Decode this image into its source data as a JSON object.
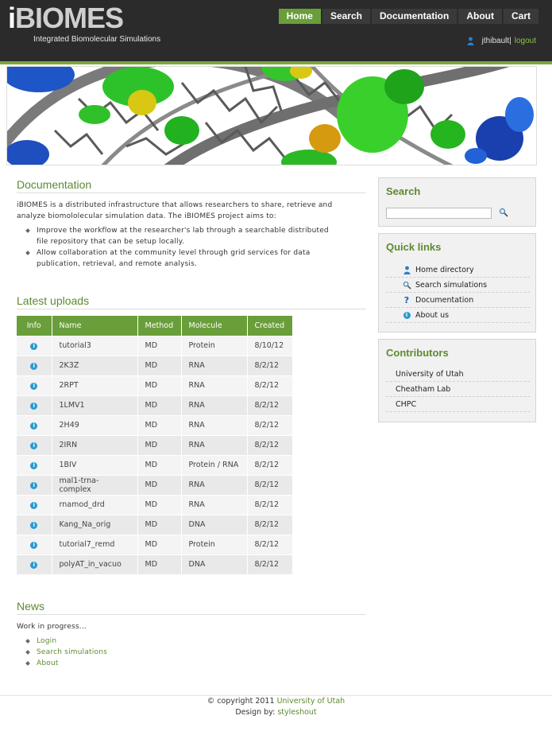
{
  "header": {
    "logo_i": "i",
    "logo_rest": "BIOMES",
    "slogan": "Integrated Biomolecular Simulations",
    "nav": [
      {
        "label": "Home",
        "active": true
      },
      {
        "label": "Search",
        "active": false
      },
      {
        "label": "Documentation",
        "active": false
      },
      {
        "label": "About",
        "active": false
      },
      {
        "label": "Cart",
        "active": false
      }
    ],
    "user": {
      "name": "jthibault",
      "separator": "|",
      "logout_label": "logout"
    }
  },
  "colors": {
    "accent": "#6a9e3a",
    "header_bg": "#2b2b2b",
    "link": "#5d8a2f"
  },
  "documentation": {
    "title": "Documentation",
    "text": "iBIOMES is a distributed infrastructure that allows researchers to share, retrieve and analyze biomololecular simulation data. The iBIOMES project aims to:",
    "bullets": [
      "Improve the workflow at the researcher's lab through a searchable distributed file repository that can be setup locally.",
      "Allow collaboration at the community level through grid services for data publication, retrieval, and remote analysis."
    ]
  },
  "uploads": {
    "title": "Latest uploads",
    "headers": {
      "info": "Info",
      "name": "Name",
      "method": "Method",
      "molecule": "Molecule",
      "created": "Created"
    },
    "rows": [
      {
        "name": "tutorial3",
        "method": "MD",
        "molecule": "Protein",
        "created": "8/10/12"
      },
      {
        "name": "2K3Z",
        "method": "MD",
        "molecule": "RNA",
        "created": "8/2/12"
      },
      {
        "name": "2RPT",
        "method": "MD",
        "molecule": "RNA",
        "created": "8/2/12"
      },
      {
        "name": "1LMV1",
        "method": "MD",
        "molecule": "RNA",
        "created": "8/2/12"
      },
      {
        "name": "2H49",
        "method": "MD",
        "molecule": "RNA",
        "created": "8/2/12"
      },
      {
        "name": "2IRN",
        "method": "MD",
        "molecule": "RNA",
        "created": "8/2/12"
      },
      {
        "name": "1BIV",
        "method": "MD",
        "molecule": "Protein / RNA",
        "created": "8/2/12"
      },
      {
        "name": "mal1-trna-complex",
        "method": "MD",
        "molecule": "RNA",
        "created": "8/2/12"
      },
      {
        "name": "rnamod_drd",
        "method": "MD",
        "molecule": "RNA",
        "created": "8/2/12"
      },
      {
        "name": "Kang_Na_orig",
        "method": "MD",
        "molecule": "DNA",
        "created": "8/2/12"
      },
      {
        "name": "tutorial7_remd",
        "method": "MD",
        "molecule": "Protein",
        "created": "8/2/12"
      },
      {
        "name": "polyAT_in_vacuo",
        "method": "MD",
        "molecule": "DNA",
        "created": "8/2/12"
      }
    ]
  },
  "news": {
    "title": "News",
    "text": "Work in progress...",
    "links": [
      "Login",
      "Search simulations",
      "About"
    ]
  },
  "sidebar": {
    "search_title": "Search",
    "search_value": "",
    "quick_links_title": "Quick links",
    "quick_links": [
      {
        "label": "Home directory",
        "icon": "user-icon"
      },
      {
        "label": "Search simulations",
        "icon": "magnifier-icon"
      },
      {
        "label": "Documentation",
        "icon": "question-icon"
      },
      {
        "label": "About us",
        "icon": "info-icon"
      }
    ],
    "contributors_title": "Contributors",
    "contributors": [
      "University of Utah",
      "Cheatham Lab",
      "CHPC"
    ]
  },
  "footer": {
    "copyright": "© copyright 2011",
    "copyright_link": "University of Utah",
    "design_by": "Design by:",
    "design_link": "styleshout"
  }
}
